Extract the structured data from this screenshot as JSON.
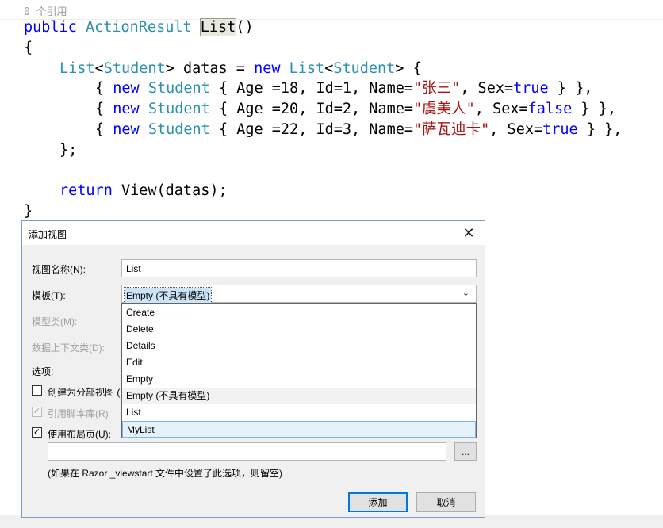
{
  "editor": {
    "ref_count": "0 个引用",
    "line1": {
      "kw": "public",
      "type": "ActionResult",
      "method": "List",
      "paren": "()"
    },
    "line2": "{",
    "line3": {
      "t1": "List",
      "lt": "<",
      "t2": "Student",
      "gt": ">",
      "rest": " datas = ",
      "kw": "new",
      "sp": " ",
      "t3": "List",
      "lt2": "<",
      "t4": "Student",
      "gt2": ">",
      "end": " {"
    },
    "rows": [
      {
        "pre": "{ ",
        "kw": "new",
        "type": "Student",
        "mid": " { Age =18, Id=1, Name=",
        "name": "\"张三\"",
        "sexp": ", Sex=",
        "sex": "true",
        "end": " } },"
      },
      {
        "pre": "{ ",
        "kw": "new",
        "type": "Student",
        "mid": " { Age =20, Id=2, Name=",
        "name": "\"虞美人\"",
        "sexp": ", Sex=",
        "sex": "false",
        "end": " } },"
      },
      {
        "pre": "{ ",
        "kw": "new",
        "type": "Student",
        "mid": " { Age =22, Id=3, Name=",
        "name": "\"萨瓦迪卡\"",
        "sexp": ", Sex=",
        "sex": "true",
        "end": " } },"
      }
    ],
    "line7": "};",
    "line9": {
      "kw": "return",
      "rest": " View(datas);"
    },
    "line10": "}"
  },
  "dialog": {
    "title": "添加视图",
    "close_glyph": "✕",
    "view_name_label": "视图名称(N):",
    "view_name_value": "List",
    "template_label": "模板(T):",
    "template_selected": "Empty (不具有模型)",
    "dropdown_arrow": "⌄",
    "model_class_label": "模型类(M):",
    "data_context_label": "数据上下文类(D):",
    "options_label": "选项:",
    "template_options": [
      "Create",
      "Delete",
      "Details",
      "Edit",
      "Empty",
      "Empty (不具有模型)",
      "List",
      "MyList"
    ],
    "partial_view": {
      "label": "创建为分部视图 (",
      "checked": false
    },
    "script_libs": {
      "label": "引用脚本库(R)",
      "checked": true,
      "disabled": true,
      "mark": "✓"
    },
    "use_layout": {
      "label": "使用布局页(U):",
      "checked": true,
      "mark": "✓"
    },
    "layout_path_value": "",
    "browse_label": "...",
    "hint": "(如果在 Razor _viewstart 文件中设置了此选项，则留空)",
    "add_button": "添加",
    "cancel_button": "取消"
  },
  "colors": {
    "keyword": "#0000ff",
    "type": "#2b91af",
    "string": "#a31515",
    "accent": "#0078d7"
  }
}
